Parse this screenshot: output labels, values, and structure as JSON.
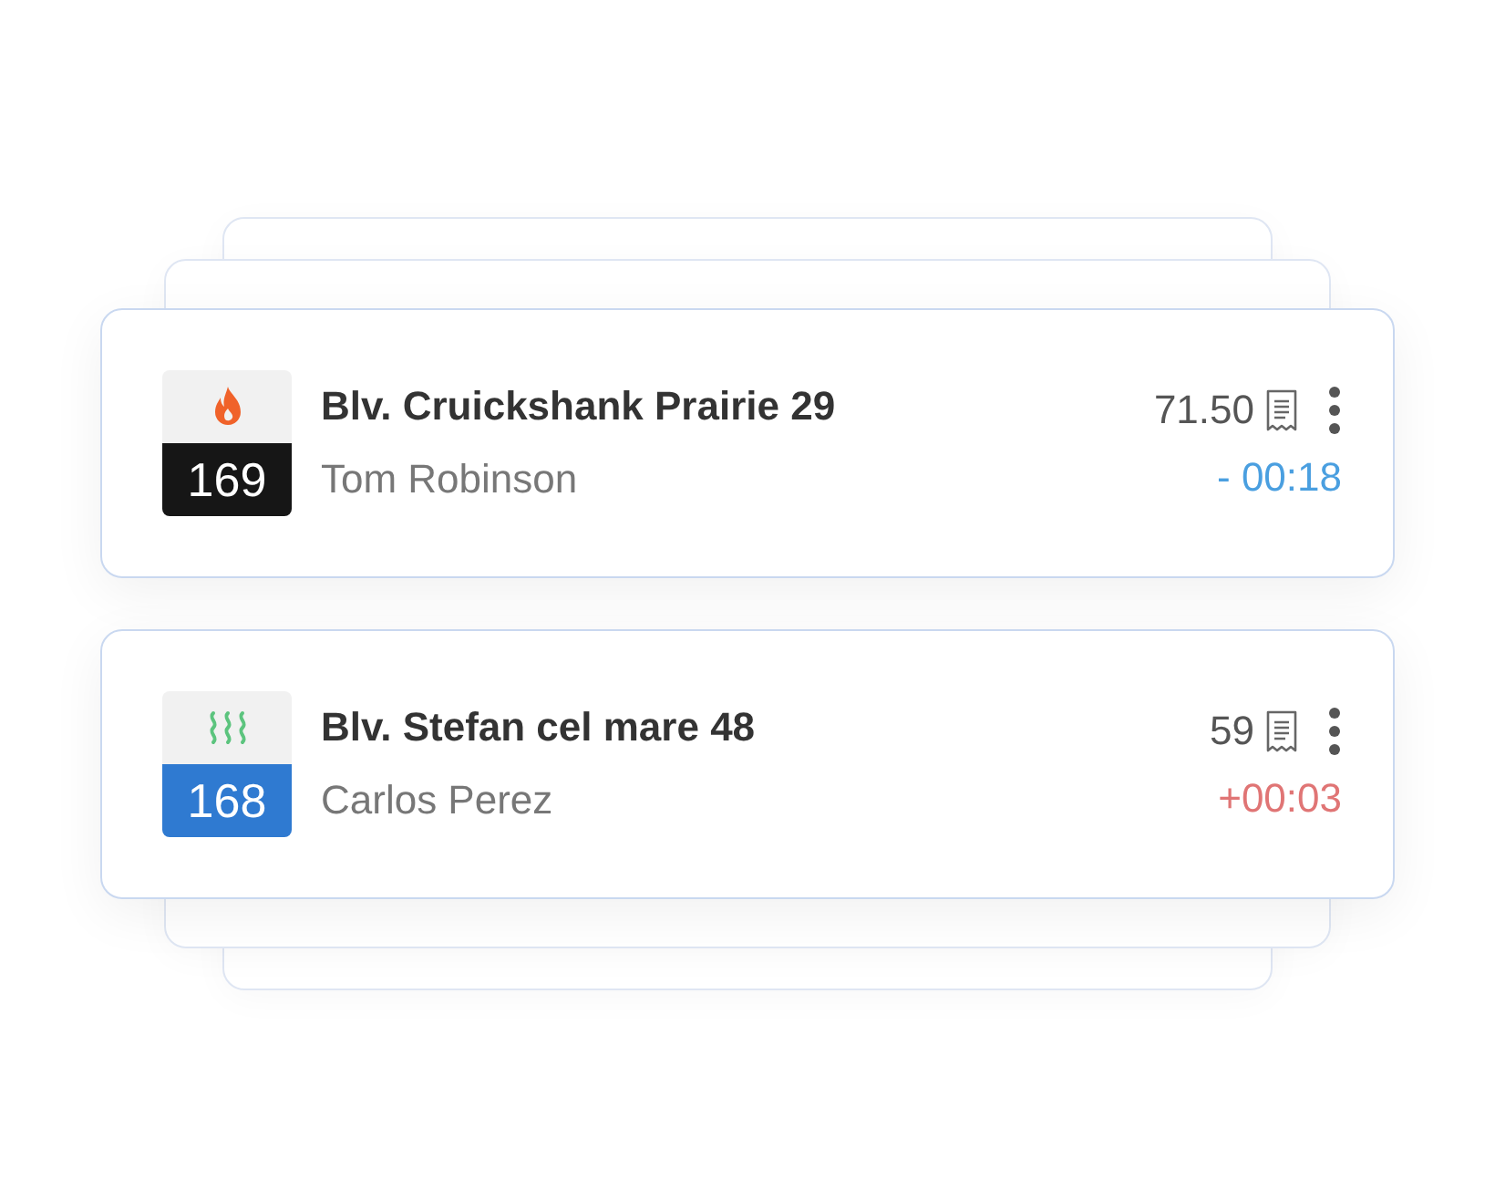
{
  "orders": [
    {
      "kind": "hot",
      "color": "#161616",
      "number": "169",
      "address": "Blv. Cruickshank Prairie 29",
      "customer": "Tom Robinson",
      "amount": "71.50",
      "time": "- 00:18",
      "late": false,
      "stacked_above": true,
      "stacked_below": false
    },
    {
      "kind": "steam",
      "color": "#2f7ad1",
      "number": "168",
      "address": "Blv. Stefan cel mare 48",
      "customer": "Carlos Perez",
      "amount": "59",
      "time": "+00:03",
      "late": true,
      "stacked_above": false,
      "stacked_below": true
    }
  ]
}
